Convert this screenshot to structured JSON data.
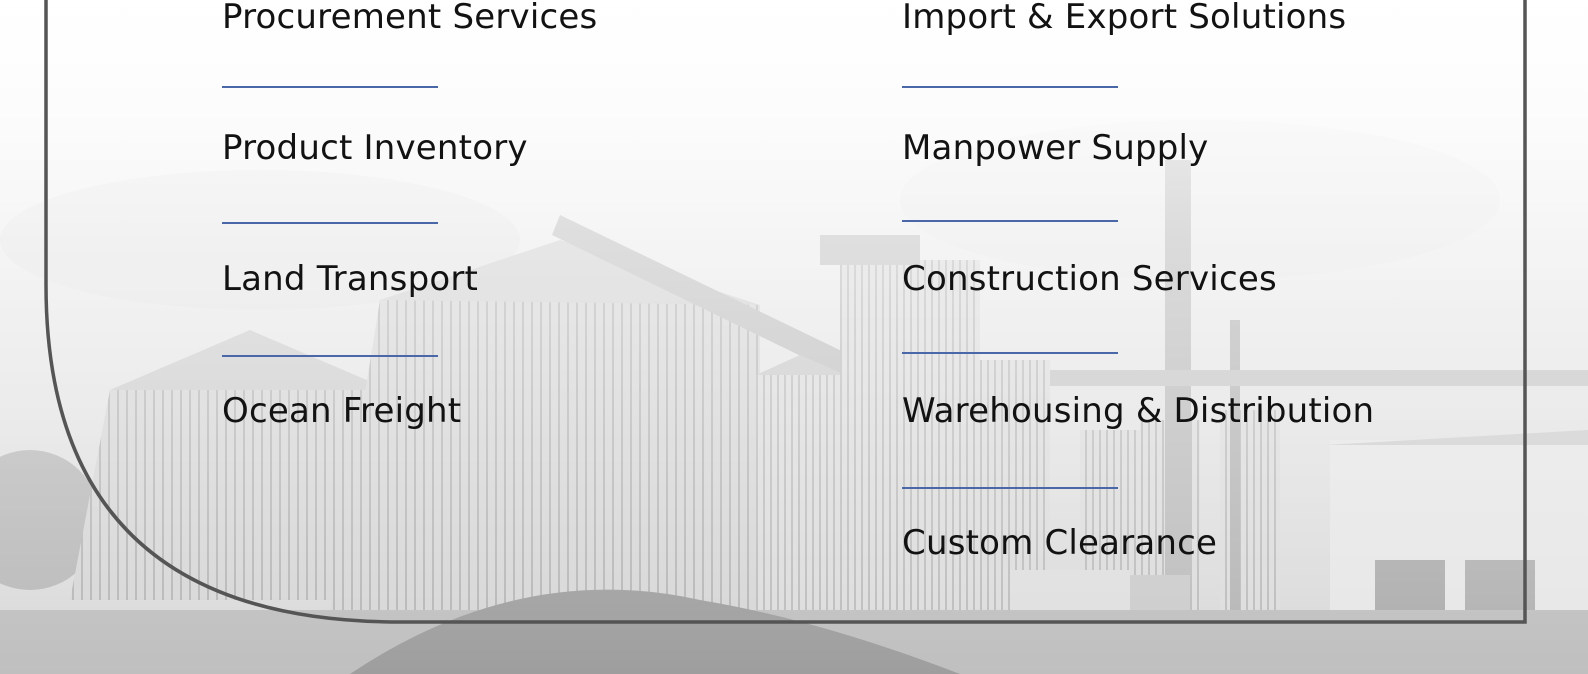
{
  "services": {
    "left": [
      "Procurement Services",
      "Product Inventory",
      "Land Transport",
      "Ocean Freight"
    ],
    "right": [
      "Import & Export Solutions",
      "Manpower Supply",
      "Construction Services",
      "Warehousing & Distribution",
      "Custom Clearance"
    ]
  },
  "colors": {
    "divider": "#4a67a8",
    "text": "#121212",
    "frame": "#555555"
  },
  "background": "grayscale-grain-silos-photo"
}
